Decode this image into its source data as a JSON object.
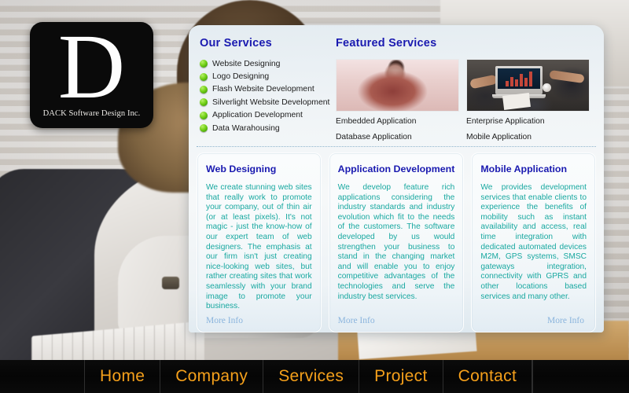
{
  "site": {
    "logo_letter": "D",
    "logo_tagline": "DACK Software Design Inc."
  },
  "our_services": {
    "title": "Our Services",
    "items": [
      {
        "label": "Website Designing",
        "bullet_icon": "green-bullet-icon"
      },
      {
        "label": "Logo Designing",
        "bullet_icon": "green-bullet-icon"
      },
      {
        "label": "Flash Website Development",
        "bullet_icon": "green-bullet-icon"
      },
      {
        "label": "Silverlight Website Development",
        "bullet_icon": "green-bullet-icon"
      },
      {
        "label": "Application Development",
        "bullet_icon": "green-bullet-icon"
      },
      {
        "label": "Data Warahousing",
        "bullet_icon": "green-bullet-icon"
      }
    ]
  },
  "featured_services": {
    "title": "Featured Services",
    "items": [
      {
        "image_name": "businessman-sepia-photo",
        "caption_1": "Embedded Application",
        "caption_2": "Database Application"
      },
      {
        "image_name": "team-meeting-laptop-photo",
        "caption_1": "Enterprise Application",
        "caption_2": "Mobile Application"
      }
    ]
  },
  "cards": [
    {
      "title": "Web Designing",
      "body": "We create stunning web sites that really work to promote your company, out of thin air (or at least pixels). It's not magic - just the know-how of our expert team of web designers. The emphasis at our firm isn't just creating nice-looking web sites, but rather creating sites that work seamlessly with your brand image to promote your business.",
      "more_info": "More Info"
    },
    {
      "title": "Application Development",
      "body": "We develop feature rich applications considering the industry standards and industry evolution which fit to the needs of the customers. The software developed by us would strengthen your business to stand in the changing market and will enable you to enjoy competitive advantages of the technologies and serve the industry best services.",
      "more_info": "More Info"
    },
    {
      "title": "Mobile Application",
      "body": "We provides development services that enable clients to experience the benefits of mobility such as instant availability and access, real time integration with dedicated automated devices M2M, GPS systems, SMSC gateways integration, connectivity with GPRS and other locations based services and many other.",
      "more_info": "More Info"
    }
  ],
  "nav": {
    "items": [
      {
        "label": "Home"
      },
      {
        "label": "Company"
      },
      {
        "label": "Services"
      },
      {
        "label": "Project"
      },
      {
        "label": "Contact"
      }
    ]
  },
  "colors": {
    "heading_blue": "#1a1ab0",
    "body_teal": "#18a8a0",
    "nav_orange": "#f5a01b",
    "nav_background": "#070707",
    "bullet_green": "#5cc415",
    "more_info_blue": "#8ab4dd",
    "panel_background": "#eef3f7"
  }
}
